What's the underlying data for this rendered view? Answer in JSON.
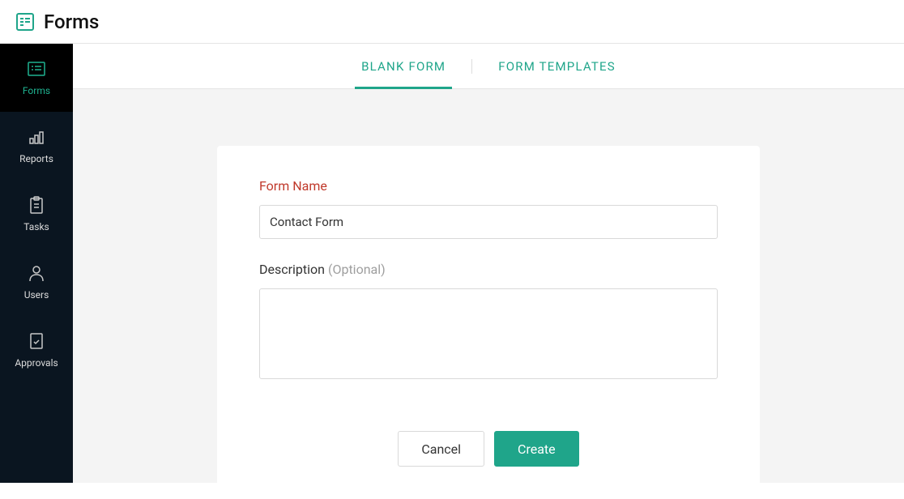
{
  "header": {
    "title": "Forms"
  },
  "sidebar": {
    "items": [
      {
        "label": "Forms",
        "active": true
      },
      {
        "label": "Reports",
        "active": false
      },
      {
        "label": "Tasks",
        "active": false
      },
      {
        "label": "Users",
        "active": false
      },
      {
        "label": "Approvals",
        "active": false
      }
    ]
  },
  "tabs": {
    "blank_form": "BLANK FORM",
    "form_templates": "FORM TEMPLATES"
  },
  "form": {
    "name_label": "Form Name",
    "name_value": "Contact Form",
    "description_label": "Description ",
    "description_optional": "(Optional)",
    "description_value": ""
  },
  "buttons": {
    "cancel": "Cancel",
    "create": "Create"
  }
}
